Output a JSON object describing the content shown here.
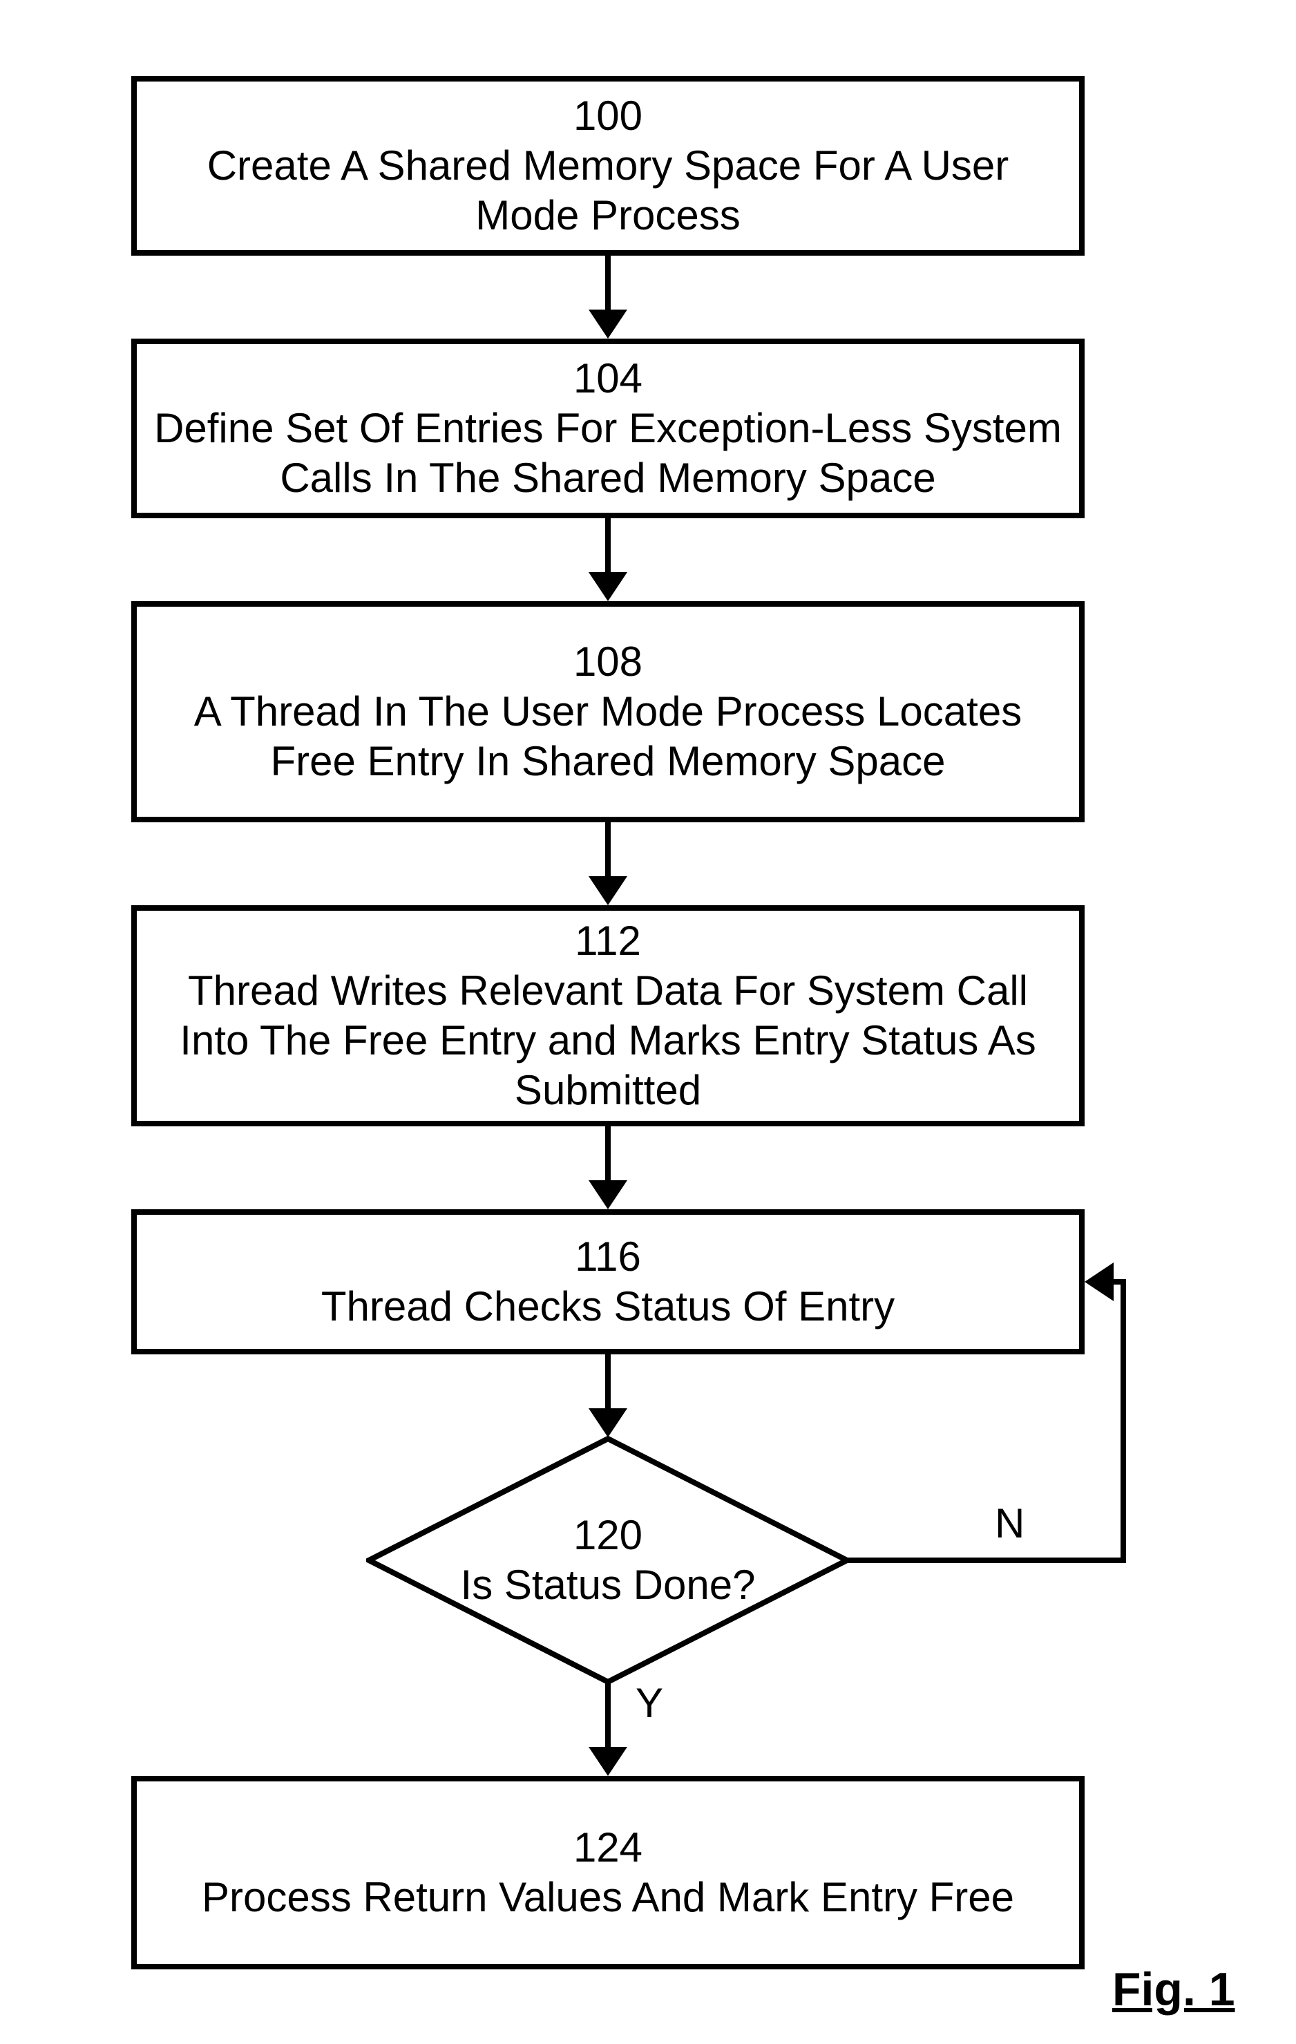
{
  "chart_data": {
    "type": "flowchart",
    "nodes": [
      {
        "id": "100",
        "shape": "process",
        "label": "Create A Shared Memory Space For A User Mode Process"
      },
      {
        "id": "104",
        "shape": "process",
        "label": "Define Set Of Entries For Exception-Less System Calls In The Shared Memory Space"
      },
      {
        "id": "108",
        "shape": "process",
        "label": "A Thread In The User Mode Process Locates Free Entry In Shared Memory Space"
      },
      {
        "id": "112",
        "shape": "process",
        "label": "Thread Writes Relevant Data For System Call Into The Free Entry and Marks Entry Status As Submitted"
      },
      {
        "id": "116",
        "shape": "process",
        "label": "Thread Checks Status Of Entry"
      },
      {
        "id": "120",
        "shape": "decision",
        "label": "Is Status Done?"
      },
      {
        "id": "124",
        "shape": "process",
        "label": "Process Return Values And Mark Entry Free"
      }
    ],
    "edges": [
      {
        "from": "100",
        "to": "104",
        "label": ""
      },
      {
        "from": "104",
        "to": "108",
        "label": ""
      },
      {
        "from": "108",
        "to": "112",
        "label": ""
      },
      {
        "from": "112",
        "to": "116",
        "label": ""
      },
      {
        "from": "116",
        "to": "120",
        "label": ""
      },
      {
        "from": "120",
        "to": "124",
        "label": "Y"
      },
      {
        "from": "120",
        "to": "116",
        "label": "N"
      }
    ]
  },
  "steps": {
    "s100": {
      "num": "100",
      "text": "Create A Shared Memory Space For A User Mode Process"
    },
    "s104": {
      "num": "104",
      "text": "Define Set Of Entries For Exception-Less System Calls In The Shared Memory Space"
    },
    "s108": {
      "num": "108",
      "text": "A Thread In The User Mode Process Locates Free Entry In Shared Memory Space"
    },
    "s112": {
      "num": "112",
      "text": "Thread Writes Relevant Data For System Call Into The Free Entry and Marks Entry Status As Submitted"
    },
    "s116": {
      "num": "116",
      "text": "Thread Checks Status Of Entry"
    },
    "s120": {
      "num": "120",
      "text": "Is Status Done?"
    },
    "s124": {
      "num": "124",
      "text": "Process Return Values And Mark Entry Free"
    }
  },
  "labels": {
    "no": "N",
    "yes": "Y"
  },
  "figure": "Fig. 1"
}
